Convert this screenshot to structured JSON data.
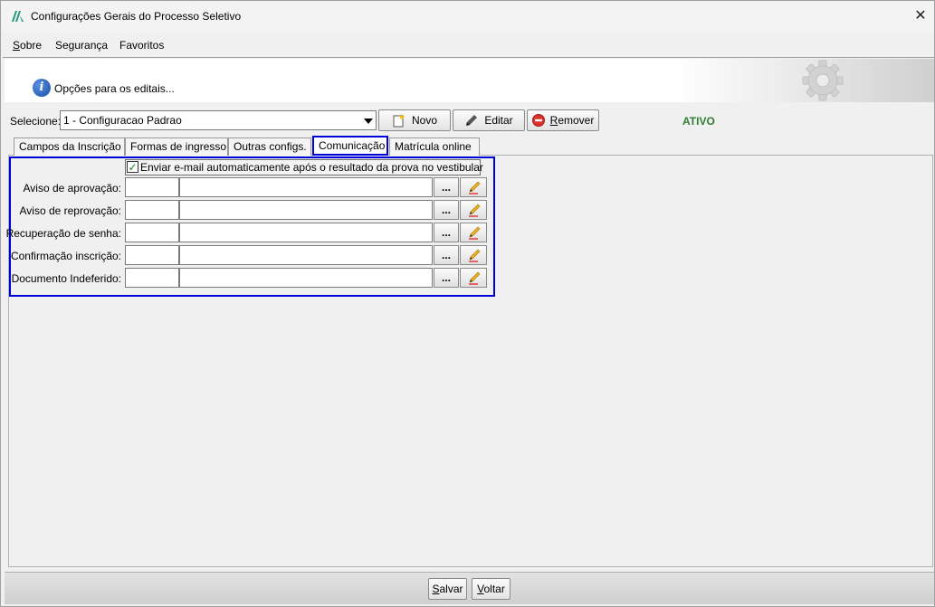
{
  "window": {
    "title": "Configurações Gerais do Processo Seletivo",
    "close_glyph": "✕"
  },
  "menu": {
    "items": [
      {
        "label": "Sobre",
        "accel": "S",
        "rest": "obre"
      },
      {
        "label": "Segurança"
      },
      {
        "label": "Favoritos"
      }
    ]
  },
  "header": {
    "text": "Opções para os editais...",
    "info_icon": "info-icon",
    "decoration_icon": "gear-icon"
  },
  "toolbar": {
    "select_label": "Selecione:",
    "select_value": "1 - Configuracao Padrao",
    "novo_label": "Novo",
    "editar_label": "Editar",
    "remover_label": "Remover",
    "remover_accel": "R",
    "remover_rest": "emover",
    "status": "ATIVO",
    "status_color": "#2e7d32"
  },
  "tabs": [
    {
      "label": "Campos da Inscrição",
      "active": false
    },
    {
      "label": "Formas de ingresso",
      "active": false
    },
    {
      "label": "Outras configs.",
      "active": false
    },
    {
      "label": "Comunicação",
      "active": true
    },
    {
      "label": "Matrícula online",
      "active": false
    }
  ],
  "communication": {
    "auto_email_checkbox": {
      "checked": true,
      "label": "Enviar e-mail automaticamente após o resultado da prova no vestibular"
    },
    "fields": [
      {
        "label": "Aviso de aprovação:",
        "code": "",
        "description": "",
        "browse_label": "..."
      },
      {
        "label": "Aviso de reprovação:",
        "code": "",
        "description": "",
        "browse_label": "..."
      },
      {
        "label": "Recuperação de senha:",
        "code": "",
        "description": "",
        "browse_label": "..."
      },
      {
        "label": "Confirmação inscrição:",
        "code": "",
        "description": "",
        "browse_label": "..."
      },
      {
        "label": "Documento Indeferido:",
        "code": "",
        "description": "",
        "browse_label": "..."
      }
    ]
  },
  "footer": {
    "salvar_label": "Salvar",
    "salvar_accel": "S",
    "salvar_rest": "alvar",
    "voltar_label": "Voltar",
    "voltar_accel": "V",
    "voltar_rest": "oltar"
  },
  "colors": {
    "highlight": "#0000d8",
    "status_active": "#2e7d32"
  }
}
